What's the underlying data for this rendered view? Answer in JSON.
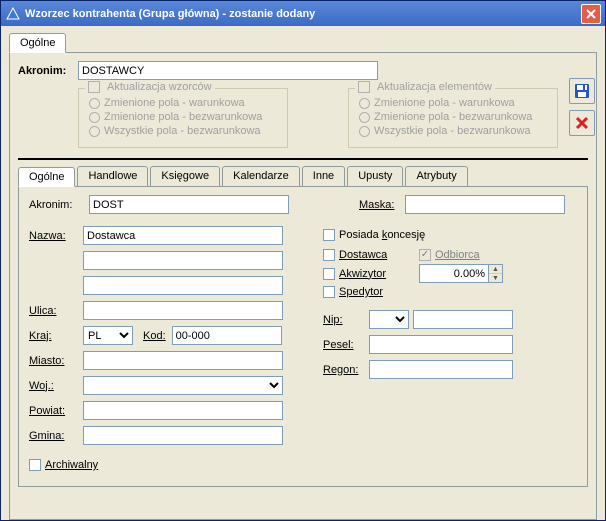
{
  "window": {
    "title": "Wzorzec kontrahenta (Grupa główna) - zostanie dodany"
  },
  "outerTabs": {
    "t0": "Ogólne"
  },
  "akronim": {
    "label": "Akronim:",
    "value": "DOSTAWCY"
  },
  "grpPatterns": {
    "legend": "Aktualizacja wzorców",
    "o1": "Zmienione pola - warunkowa",
    "o2": "Zmienione pola - bezwarunkowa",
    "o3": "Wszystkie pola - bezwarunkowa"
  },
  "grpElements": {
    "legend": "Aktualizacja elementów",
    "o1": "Zmienione pola - warunkowa",
    "o2": "Zmienione pola - bezwarunkowa",
    "o3": "Wszystkie pola - bezwarunkowa"
  },
  "innerTabs": {
    "t0": "Ogólne",
    "t1": "Handlowe",
    "t2": "Księgowe",
    "t3": "Kalendarze",
    "t4": "Inne",
    "t5": "Upusty",
    "t6": "Atrybuty"
  },
  "form": {
    "akronim": {
      "label": "Akronim:",
      "value": "DOST"
    },
    "maska": {
      "label": "Maska:",
      "value": ""
    },
    "nazwa": {
      "label": "Nazwa:",
      "value": "Dostawca"
    },
    "ulica": {
      "label": "Ulica:",
      "value": ""
    },
    "kraj": {
      "label": "Kraj:",
      "value": "PL"
    },
    "kod": {
      "label": "Kod:",
      "value": "00-000"
    },
    "miasto": {
      "label": "Miasto:",
      "value": ""
    },
    "woj": {
      "label": "Woj.:",
      "value": ""
    },
    "powiat": {
      "label": "Powiat:",
      "value": ""
    },
    "gmina": {
      "label": "Gmina:",
      "value": ""
    },
    "archiwalny": {
      "label": "Archiwalny"
    }
  },
  "right": {
    "koncesja": "Posiada koncesję",
    "dostawca": "Dostawca",
    "odbiorca": "Odbiorca",
    "akwizytor": "Akwizytor",
    "akwizytor_val": "0.00%",
    "spedytor": "Spedytor",
    "nip": "Nip:",
    "pesel": "Pesel:",
    "regon": "Regon:"
  }
}
